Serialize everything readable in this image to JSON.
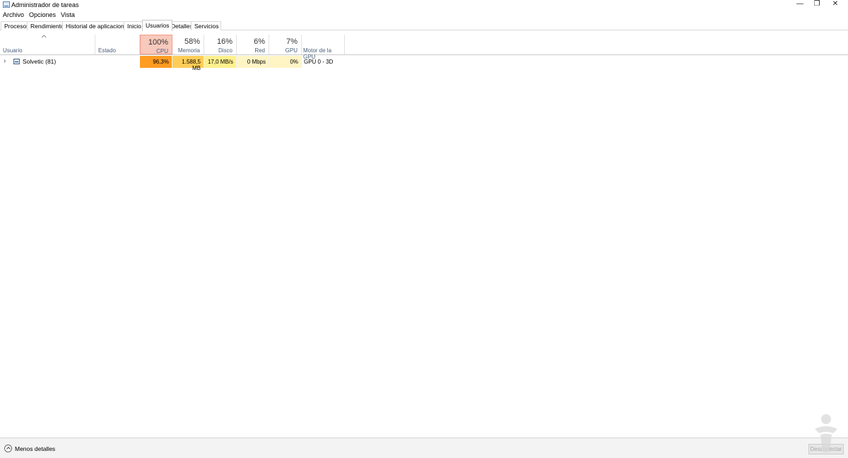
{
  "window": {
    "title": "Administrador de tareas",
    "controls": {
      "minimize": "—",
      "restore": "❐",
      "close": "✕"
    }
  },
  "menu": [
    "Archivo",
    "Opciones",
    "Vista"
  ],
  "tabs": [
    {
      "label": "Procesos"
    },
    {
      "label": "Rendimiento"
    },
    {
      "label": "Historial de aplicaciones"
    },
    {
      "label": "Inicio"
    },
    {
      "label": "Usuarios",
      "active": true
    },
    {
      "label": "Detalles"
    },
    {
      "label": "Servicios"
    }
  ],
  "columns": {
    "usuario": {
      "label": "Usuario"
    },
    "estado": {
      "label": "Estado"
    },
    "cpu": {
      "pct": "100%",
      "label": "CPU"
    },
    "memoria": {
      "pct": "58%",
      "label": "Memoria"
    },
    "disco": {
      "pct": "16%",
      "label": "Disco"
    },
    "red": {
      "pct": "6%",
      "label": "Red"
    },
    "gpu": {
      "pct": "7%",
      "label": "GPU"
    },
    "motor_gpu": {
      "label": "Motor de la GPU"
    }
  },
  "rows": [
    {
      "user": "Solvetic (81)",
      "cpu": "96,3%",
      "memoria": "1.588,5 MB",
      "disco": "17,0 MB/s",
      "red": "0 Mbps",
      "gpu": "0%",
      "motor_gpu": "GPU 0 - 3D"
    }
  ],
  "colors": {
    "cpu_header": "#f8c9bd",
    "cpu_cell": "#ff9c22",
    "memoria_cell": "#ffcd57",
    "disco_cell": "#fff08c",
    "red_cell": "#fff4c4",
    "gpu_cell": "#fff4c4"
  },
  "footer": {
    "fewer_details": "Menos detalles",
    "disconnect_button": "Desconectar"
  }
}
